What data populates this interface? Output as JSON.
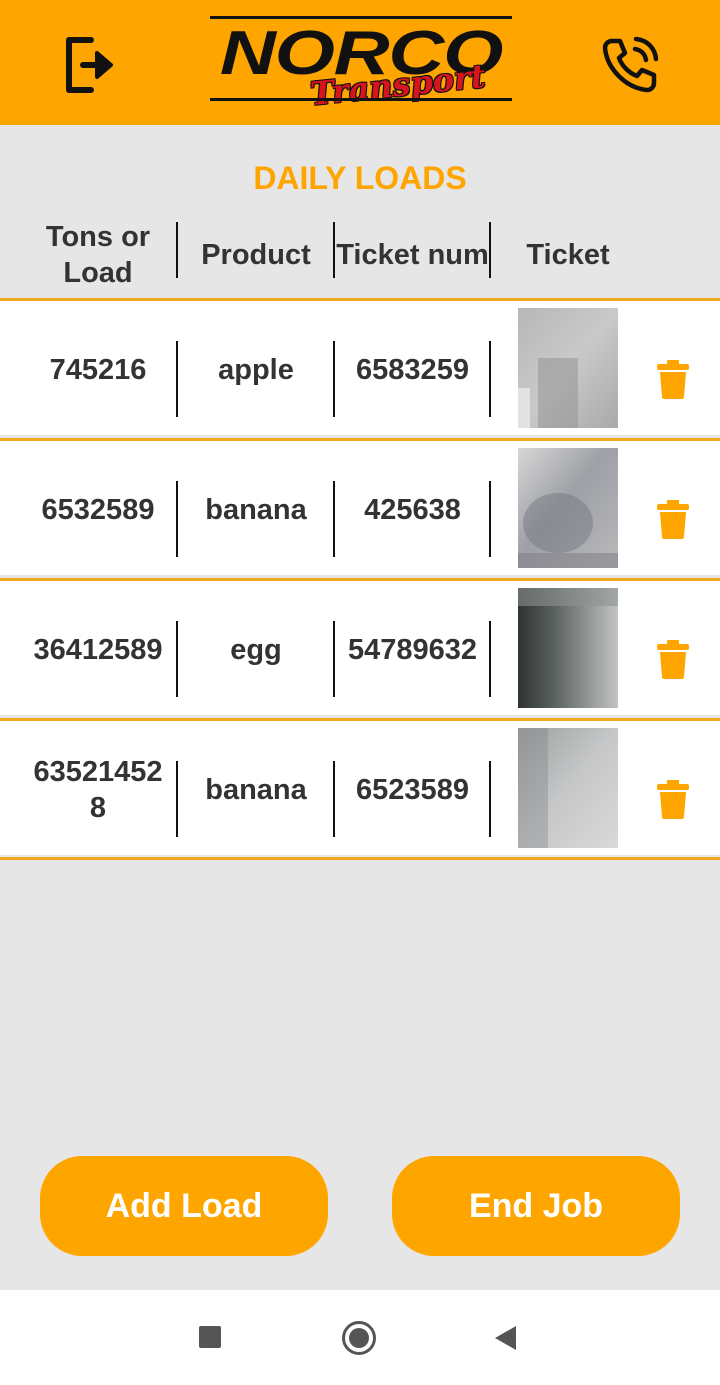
{
  "header": {
    "logo_brand": "NORCO",
    "logo_sub": "Transport",
    "icons": {
      "logout": "logout-icon",
      "call": "phone-call-icon"
    }
  },
  "title": "DAILY LOADS",
  "table": {
    "headers": [
      "Tons or Load",
      "Product",
      "Ticket num",
      "Ticket"
    ],
    "rows": [
      {
        "tons": "745216",
        "product": "apple",
        "ticket_num": "6583259"
      },
      {
        "tons": "6532589",
        "product": "banana",
        "ticket_num": "425638"
      },
      {
        "tons": "36412589",
        "product": "egg",
        "ticket_num": "54789632"
      },
      {
        "tons": "635214528",
        "product": "banana",
        "ticket_num": "6523589"
      }
    ]
  },
  "buttons": {
    "add_load": "Add Load",
    "end_job": "End Job"
  },
  "colors": {
    "accent": "#ffa500",
    "background": "#e6e6e6",
    "row_border": "#f0a81c"
  }
}
